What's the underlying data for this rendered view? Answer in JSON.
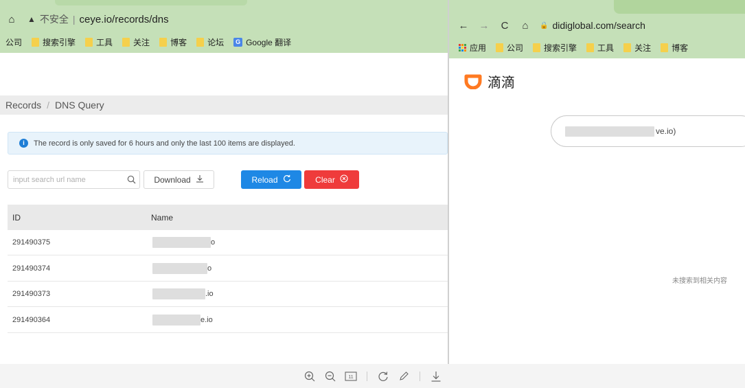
{
  "left_window": {
    "insecure_label": "不安全",
    "separator": "|",
    "url": "ceye.io/records/dns",
    "bookmarks": [
      {
        "label": "公司",
        "icon": "none"
      },
      {
        "label": "搜索引擎",
        "icon": "folder-icon"
      },
      {
        "label": "工具",
        "icon": "folder-icon"
      },
      {
        "label": "关注",
        "icon": "folder-icon"
      },
      {
        "label": "博客",
        "icon": "folder-icon"
      },
      {
        "label": "论坛",
        "icon": "folder-icon"
      },
      {
        "label": "Google 翻译",
        "icon": "google-translate-icon"
      }
    ],
    "breadcrumb": {
      "root": "Records",
      "separator": "/",
      "current": "DNS Query"
    },
    "info_message": "The record is only saved for 6 hours and only the last 100 items are displayed.",
    "search": {
      "placeholder": "input search url name",
      "value": ""
    },
    "buttons": {
      "download": "Download",
      "reload": "Reload",
      "clear": "Clear"
    },
    "table": {
      "headers": {
        "id": "ID",
        "name": "Name"
      },
      "rows": [
        {
          "id": "291490375",
          "name_suffix": "o"
        },
        {
          "id": "291490374",
          "name_suffix": "o"
        },
        {
          "id": "291490373",
          "name_suffix": ".io"
        },
        {
          "id": "291490364",
          "name_suffix": "e.io"
        }
      ]
    }
  },
  "right_window": {
    "url": "didiglobal.com/search",
    "bookmarks": [
      {
        "label": "应用",
        "icon": "apps-icon"
      },
      {
        "label": "公司",
        "icon": "folder-icon"
      },
      {
        "label": "搜索引擎",
        "icon": "folder-icon"
      },
      {
        "label": "工具",
        "icon": "folder-icon"
      },
      {
        "label": "关注",
        "icon": "folder-icon"
      },
      {
        "label": "博客",
        "icon": "folder-icon"
      }
    ],
    "brand_name": "滴滴",
    "search_value_suffix": "ve.io)",
    "no_result_text": "未搜索到相关内容"
  },
  "toolbar": {
    "page_indicator": "11"
  },
  "colors": {
    "browser_bar": "#c5e0b8",
    "reload_button": "#1e88e5",
    "clear_button": "#ef3b3b",
    "info_icon": "#1e7ed6",
    "brand_orange": "#ff7a22",
    "bookmark_folder": "#f5d04c"
  }
}
